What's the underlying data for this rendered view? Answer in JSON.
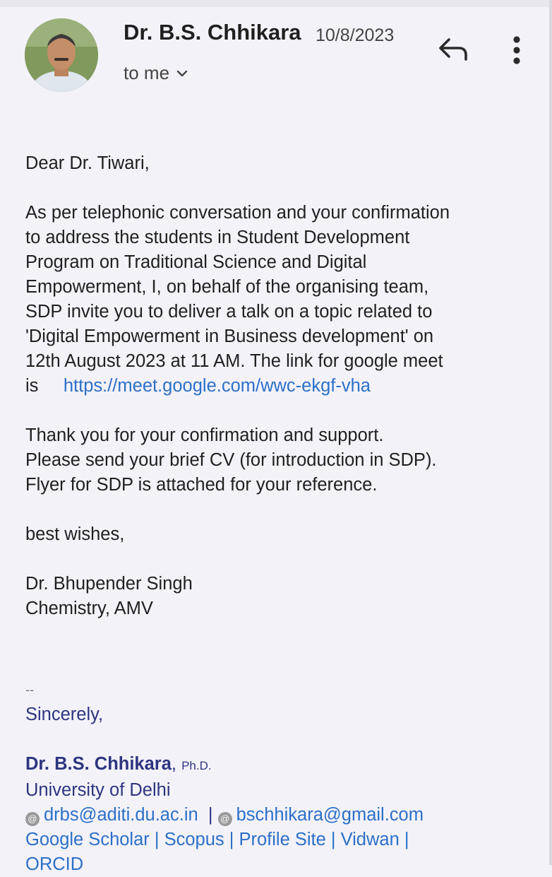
{
  "header": {
    "sender": "Dr. B.S. Chhikara",
    "date": "10/8/2023",
    "recipient_label": "to me",
    "icons": [
      "avatar",
      "chevron-down-icon",
      "reply-icon",
      "more-vert-icon"
    ]
  },
  "body": {
    "greeting": "Dear Dr. Tiwari,",
    "paragraph1": [
      "As per telephonic conversation and your confirmation",
      "to address the students in Student Development",
      "Program on Traditional Science and Digital",
      "Empowerment, I, on behalf of the organising team,",
      "SDP invite you to deliver a talk on a topic related to",
      "'Digital Empowerment in Business development' on",
      "12th August 2023 at 11 AM. The link for google meet"
    ],
    "link_prefix": "is",
    "meet_link": "https://meet.google.com/wwc-ekgf-vha",
    "paragraph2": [
      "Thank you for your confirmation and support.",
      "Please send your brief CV (for introduction in SDP).",
      "Flyer for SDP is attached for your reference."
    ],
    "closing": "best wishes,",
    "name": "Dr. Bhupender Singh",
    "department": "Chemistry, AMV"
  },
  "signature": {
    "separator": "--",
    "sincerely": "Sincerely,",
    "name": "Dr. B.S. Chhikara",
    "degree": "Ph.D.",
    "affiliation": "University of Delhi",
    "email1": "drbs@aditi.du.ac.in",
    "email_separator": "|",
    "email2": "bschhikara@gmail.com",
    "links": [
      "Google Scholar",
      "Scopus",
      "Profile Site",
      "Vidwan",
      "ORCID"
    ]
  },
  "colors": {
    "background": "#f4f2f9",
    "link": "#2b70c8",
    "signature": "#2d3580"
  }
}
